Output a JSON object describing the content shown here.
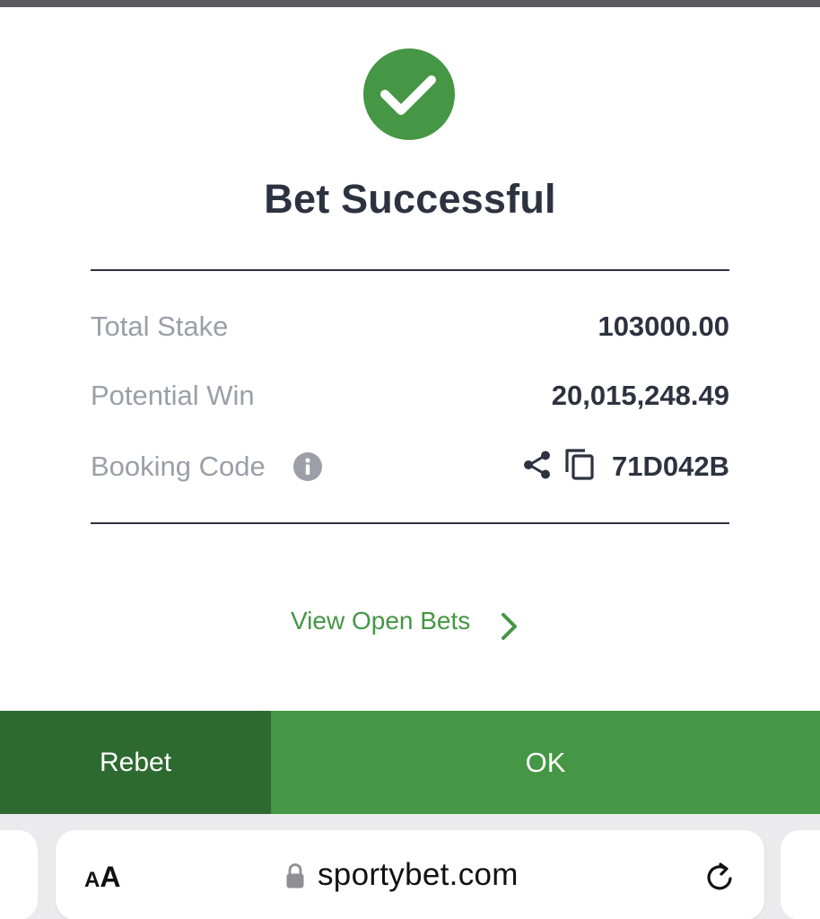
{
  "dialog": {
    "title": "Bet Successful",
    "status_icon": "check-circle-icon",
    "rows": {
      "total_stake": {
        "label": "Total Stake",
        "value": "103000.00"
      },
      "potential_win": {
        "label": "Potential Win",
        "value": "20,015,248.49"
      },
      "booking_code": {
        "label": "Booking Code",
        "value": "71D042B"
      }
    },
    "view_open_bets": "View Open Bets"
  },
  "actions": {
    "rebet_label": "Rebet",
    "ok_label": "OK"
  },
  "browser": {
    "aa_small": "A",
    "aa_big": "A",
    "url": "sportybet.com"
  },
  "colors": {
    "accent_green": "#459645",
    "dark_green": "#2d6a2f",
    "text_dark": "#2d3240",
    "text_muted": "#9c9ea8"
  }
}
